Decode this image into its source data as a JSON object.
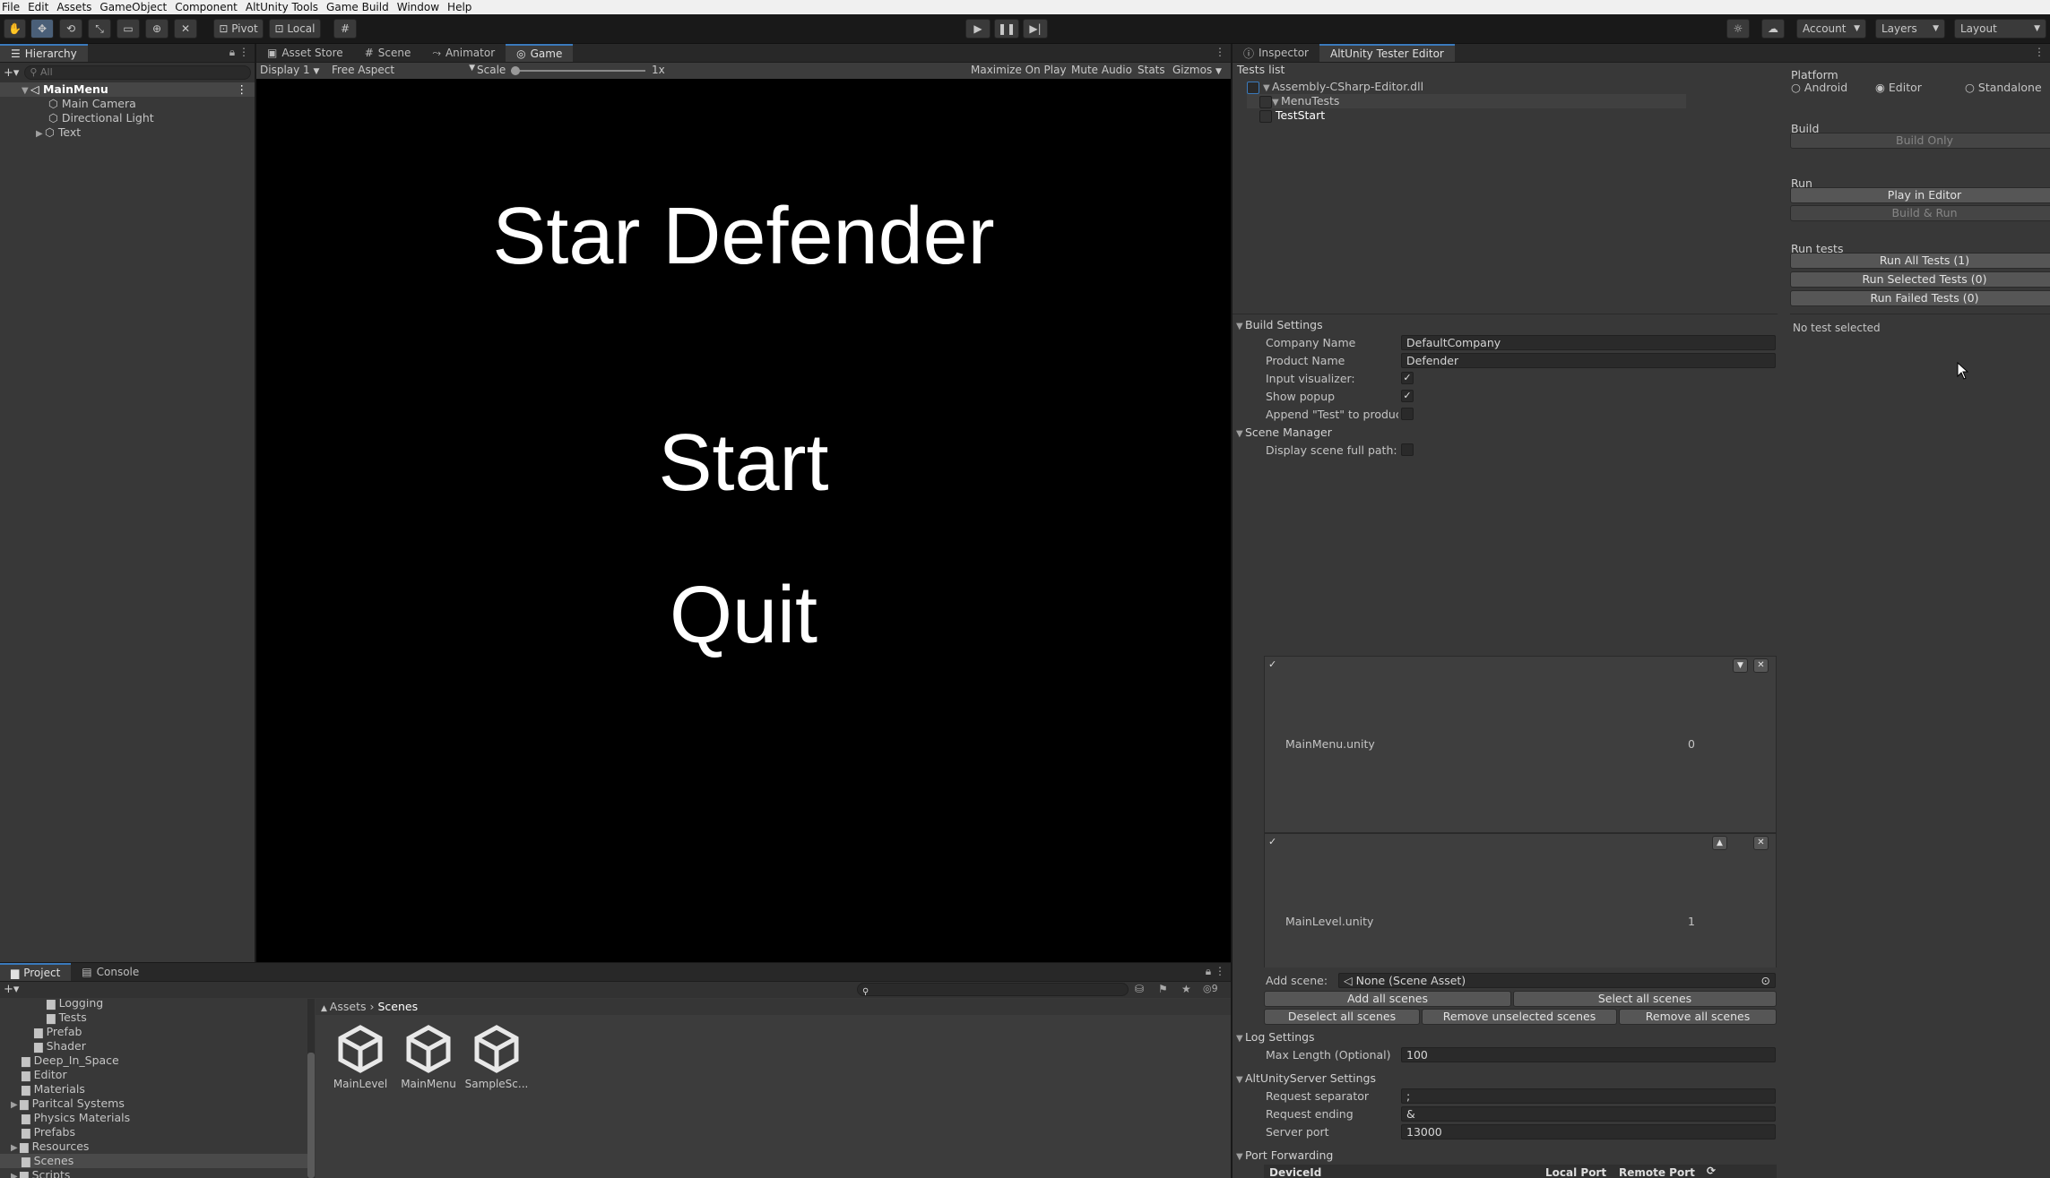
{
  "menu": [
    "File",
    "Edit",
    "Assets",
    "GameObject",
    "Component",
    "AltUnity Tools",
    "Game Build",
    "Window",
    "Help"
  ],
  "toolbar": {
    "pivot": "Pivot",
    "local": "Local",
    "account": "Account",
    "layers": "Layers",
    "layout": "Layout"
  },
  "hierarchy": {
    "tab": "Hierarchy",
    "search_placeholder": "All",
    "scene": "MainMenu",
    "items": [
      "Main Camera",
      "Directional Light",
      "Text"
    ]
  },
  "center_tabs": [
    "Asset Store",
    "Scene",
    "Animator",
    "Game"
  ],
  "game_toolbar": {
    "display": "Display 1",
    "aspect": "Free Aspect",
    "scale_label": "Scale",
    "scale_value": "1x",
    "maximize": "Maximize On Play",
    "mute": "Mute Audio",
    "stats": "Stats",
    "gizmos": "Gizmos"
  },
  "game": {
    "title": "Star Defender",
    "start": "Start",
    "quit": "Quit"
  },
  "inspector_tabs": [
    "Inspector",
    "AltUnity Tester Editor"
  ],
  "tests": {
    "header": "Tests list",
    "assembly": "Assembly-CSharp-Editor.dll",
    "suite": "MenuTests",
    "test": "TestStart"
  },
  "platform": {
    "header": "Platform",
    "options": [
      "Android",
      "Editor",
      "Standalone"
    ],
    "selected": "Editor"
  },
  "build": {
    "header": "Build",
    "build_only": "Build Only"
  },
  "run": {
    "header": "Run",
    "play_in_editor": "Play in Editor",
    "build_and_run": "Build & Run"
  },
  "run_tests": {
    "header": "Run tests",
    "all": "Run All Tests (1)",
    "selected": "Run Selected Tests (0)",
    "failed": "Run Failed Tests (0)",
    "status": "No test selected"
  },
  "build_settings": {
    "header": "Build Settings",
    "company_label": "Company Name",
    "company_value": "DefaultCompany",
    "product_label": "Product Name",
    "product_value": "Defender",
    "input_visualizer": "Input visualizer:",
    "show_popup": "Show popup",
    "append_test": "Append \"Test\" to product r"
  },
  "scene_manager": {
    "header": "Scene Manager",
    "full_path": "Display scene full path:",
    "scenes": [
      {
        "name": "MainMenu.unity",
        "index": "0"
      },
      {
        "name": "MainLevel.unity",
        "index": "1"
      }
    ],
    "add_scene_label": "Add scene:",
    "add_scene_value": "None (Scene Asset)",
    "add_all": "Add all scenes",
    "select_all": "Select all scenes",
    "deselect_all": "Deselect all scenes",
    "remove_unselected": "Remove unselected scenes",
    "remove_all": "Remove all scenes"
  },
  "log_settings": {
    "header": "Log Settings",
    "max_length_label": "Max Length (Optional)",
    "max_length_value": "100"
  },
  "server_settings": {
    "header": "AltUnityServer Settings",
    "separator_label": "Request separator",
    "separator_value": ";",
    "ending_label": "Request ending",
    "ending_value": "&",
    "port_label": "Server port",
    "port_value": "13000"
  },
  "port_forwarding": {
    "header": "Port Forwarding",
    "device": "DeviceId",
    "local": "Local Port",
    "remote": "Remote Port"
  },
  "project": {
    "tabs": [
      "Project",
      "Console"
    ],
    "tree": [
      "Logging",
      "Tests",
      "Prefab",
      "Shader",
      "Deep_In_Space",
      "Editor",
      "Materials",
      "Paritcal Systems",
      "Physics Materials",
      "Prefabs",
      "Resources",
      "Scenes",
      "Scripts"
    ],
    "breadcrumb": [
      "Assets",
      "Scenes"
    ],
    "assets": [
      "MainLevel",
      "MainMenu",
      "SampleSc..."
    ],
    "hidden_count": "9"
  }
}
